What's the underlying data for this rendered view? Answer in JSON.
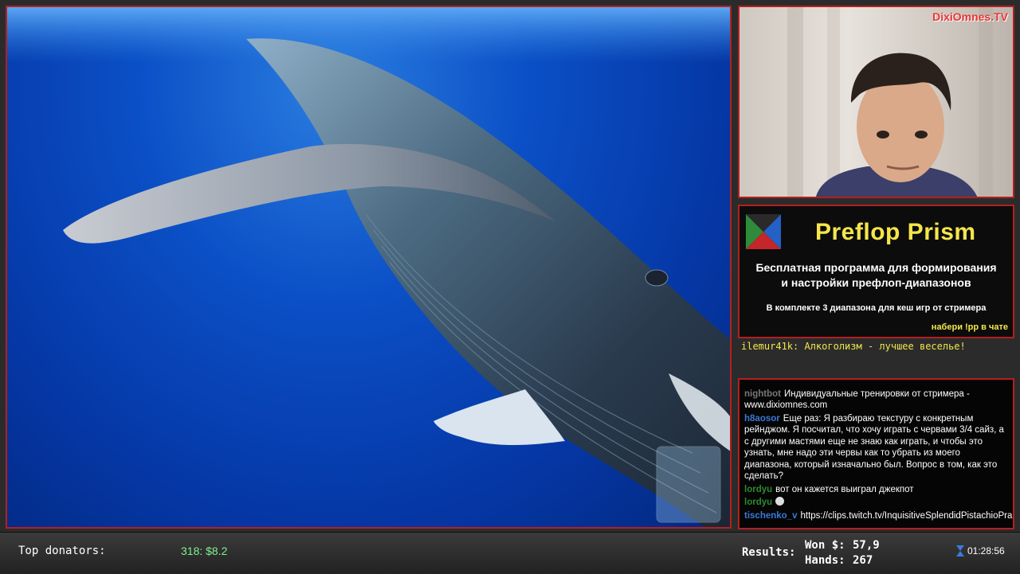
{
  "webcam": {
    "brand": "DixiOmnes.TV"
  },
  "promo": {
    "title": "Preflop Prism",
    "description_line1": "Бесплатная программа для формирования",
    "description_line2": "и настройки префлоп-диапазонов",
    "note": "В комплекте 3 диапазона для кеш игр от стримера",
    "cta": "набери !pp в чате",
    "logo_colors": [
      "#2e8b3a",
      "#2461c7",
      "#c5262a",
      "#111111"
    ]
  },
  "ticker": {
    "text": "ilemur41k: Алкоголизм - лучшее веселье!"
  },
  "chat": {
    "messages": [
      {
        "user": "nightbot",
        "user_color": "gray",
        "text": "Индивидуальные тренировки от стримера - www.dixiomnes.com"
      },
      {
        "user": "h8aosor",
        "user_color": "blue",
        "text": "Еще раз: Я разбираю текстуру с конкретным рейнджом. Я посчитал, что хочу играть с червами 3/4 сайз, а с другими мастями еще не знаю как играть, и чтобы это узнать, мне надо эти червы как то убрать из моего диапазона, который изначально был. Вопрос в том, как это сделать?"
      },
      {
        "user": "lordyu",
        "user_color": "green",
        "text": "вот он кажется выиграл джекпот"
      },
      {
        "user": "lordyu",
        "user_color": "green",
        "text": "",
        "emote": "face-emote"
      },
      {
        "user": "tischenko_v",
        "user_color": "blue",
        "text": "https://clips.twitch.tv/InquisitiveSplendidPistachioPraiseIt"
      }
    ]
  },
  "bottom_bar": {
    "top_donators_label": "Top donators:",
    "top_donator_value": "318: $8.2",
    "results_label": "Results:",
    "won_label": "Won $:",
    "won_value": "57,9",
    "hands_label": "Hands:",
    "hands_value": "267",
    "timer": "01:28:56"
  },
  "colors": {
    "accent_red": "#b51f1f",
    "promo_yellow": "#f4e64a",
    "donor_green": "#7ef28a"
  }
}
